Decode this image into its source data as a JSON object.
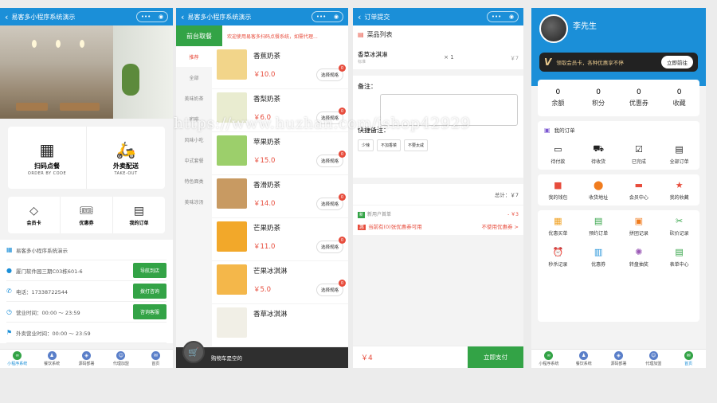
{
  "phone1": {
    "title": "易客多小程序系统演示",
    "menu_dots": "•••",
    "scan": {
      "title": "扫码点餐",
      "sub": "ORDER BY CODE"
    },
    "takeout": {
      "title": "外卖配送",
      "sub": "TAKE-OUT"
    },
    "quick": [
      "会员卡",
      "优惠券",
      "我的订单"
    ],
    "store_name": "易客多小程序系统演示",
    "address": "厦门软件园三期C03栋601-6",
    "phone": "电话：17338722544",
    "hours": "营业时间：00:00 ～ 23:59",
    "takeout_hours": "外卖营业时间：00:00 ～ 23:59",
    "btn_nav": "导航到店",
    "btn_call": "拨打咨询",
    "btn_service": "咨询客服",
    "tabs": [
      "小程序系统",
      "餐饮系统",
      "源码部署",
      "代理加盟",
      "首页"
    ]
  },
  "phone2": {
    "title": "易客多小程序系统演示",
    "front_pickup": "前台取餐",
    "notice": "欢迎使用易客多扫码点餐系统，如需代理...",
    "categories": [
      "推荐",
      "全部",
      "美味奶茶",
      "咖啡",
      "风味小吃",
      "中式套餐",
      "特色面类",
      "美味凉汤"
    ],
    "spec_label": "选择规格",
    "badge": "0",
    "products": [
      {
        "name": "香蕉奶茶",
        "price": "￥10.0",
        "color": "#f2d58a"
      },
      {
        "name": "香梨奶茶",
        "price": "￥6.0",
        "color": "#e9ecd0"
      },
      {
        "name": "苹果奶茶",
        "price": "￥15.0",
        "color": "#9ccf6b"
      },
      {
        "name": "香滑奶茶",
        "price": "￥14.0",
        "color": "#c89a62"
      },
      {
        "name": "芒果奶茶",
        "price": "￥11.0",
        "color": "#f2a82a"
      },
      {
        "name": "芒果冰淇淋",
        "price": "￥5.0",
        "color": "#f4b74a"
      },
      {
        "name": "香草冰淇淋",
        "price": "",
        "color": "#f1efe6"
      }
    ],
    "cart_empty": "购物车是空的"
  },
  "phone3": {
    "title": "订单提交",
    "dish_list": "菜品列表",
    "item_name": "香草冰淇淋",
    "item_sub": "标准",
    "item_qty": "× 1",
    "item_price": "￥7",
    "remark": "备注：",
    "quick_remark": "快捷备注：",
    "quick_tags": [
      "少辣",
      "不加香菜",
      "不要太咸"
    ],
    "total": "总计：￥7",
    "new_badge": "新",
    "new_user": "新用户首单",
    "discount": "- ￥3",
    "coupon_badge": "惠",
    "coupon_text": "当前有(0)张优惠券可用",
    "coupon_unused": "不使用优惠券 >",
    "pay_amount": "￥4",
    "pay_btn": "立即支付"
  },
  "phone4": {
    "username": "李先生",
    "vip_v": "V",
    "vip_text": "领取会员卡，各种优惠享不停",
    "vip_btn": "立即前往",
    "stats": [
      {
        "n": "0",
        "l": "余额"
      },
      {
        "n": "0",
        "l": "积分"
      },
      {
        "n": "0",
        "l": "优惠券"
      },
      {
        "n": "0",
        "l": "收藏"
      }
    ],
    "my_orders": "我的订单",
    "order_items": [
      "待付款",
      "待收货",
      "已完成",
      "全部订单"
    ],
    "row2": [
      "我的钱包",
      "收货地址",
      "会员中心",
      "我的收藏"
    ],
    "row3": [
      "优惠买单",
      "预约订单",
      "拼团记录",
      "砍价记录"
    ],
    "row4": [
      "秒杀记录",
      "优惠券",
      "转盘抽奖",
      "表单中心"
    ],
    "tabs": [
      "小程序系统",
      "餐饮系统",
      "源码部署",
      "代理加盟",
      "首页"
    ]
  },
  "watermark": "https://www.huzhan.com/ishop42929",
  "colors": {
    "primary": "#1b8fd8",
    "green": "#33a346",
    "red": "#e74c3c"
  }
}
